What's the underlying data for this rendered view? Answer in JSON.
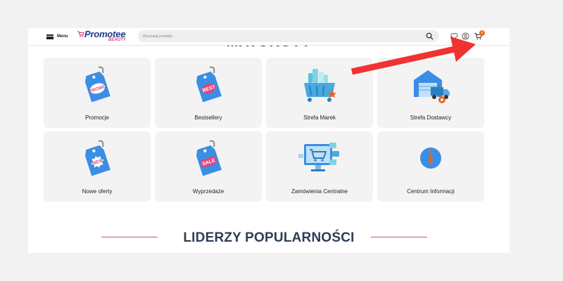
{
  "header": {
    "menu_label": "Menu",
    "logo_text": "Promotee",
    "logo_sub": "BEAUTY",
    "search_placeholder": "Wyszukaj produkty",
    "cart_count": "0"
  },
  "partial_title": "MATOKOTY",
  "tiles": [
    {
      "label": "Promocje",
      "icon": "promo-tag-icon"
    },
    {
      "label": "Bestsellery",
      "icon": "best-tag-icon"
    },
    {
      "label": "Strefa Marek",
      "icon": "cosmetics-basket-icon"
    },
    {
      "label": "Strefa Dostawcy",
      "icon": "warehouse-truck-icon"
    },
    {
      "label": "Nowe oferty",
      "icon": "new-tag-icon"
    },
    {
      "label": "Wyprzedaże",
      "icon": "sale-tag-icon"
    },
    {
      "label": "Zamówienia Centralne",
      "icon": "online-shop-icon"
    },
    {
      "label": "Centrum Informacji",
      "icon": "info-icon"
    }
  ],
  "tag_texts": [
    "PROMO",
    "BEST",
    "NEW",
    "SALE"
  ],
  "section_title": "LIDERZY POPULARNOŚCI",
  "colors": {
    "accent_orange": "#e8671d",
    "brand_blue": "#1f3b8f",
    "brand_pink": "#e0457b",
    "annotation_red": "#f03232",
    "tag_blue": "#3a8ee6"
  }
}
